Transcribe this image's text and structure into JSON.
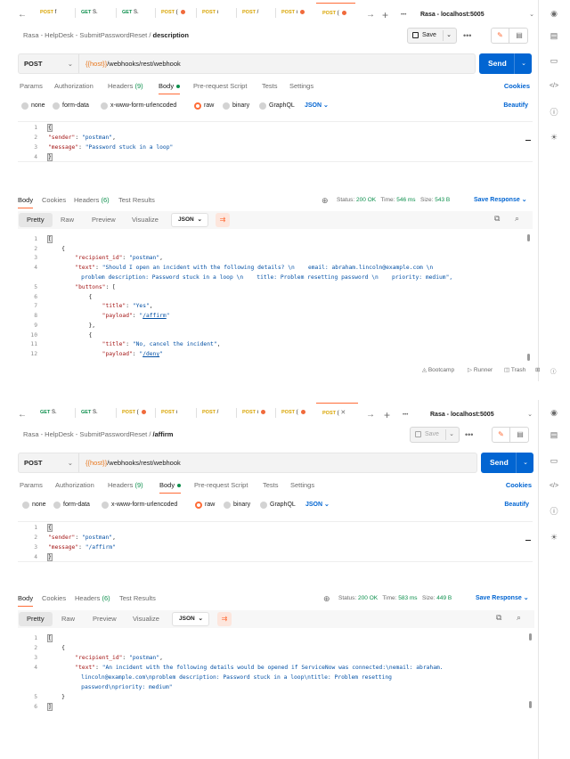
{
  "tabs": [
    {
      "method": "POST",
      "tail": "f",
      "dot": false
    },
    {
      "method": "GET",
      "tail": "S.",
      "dot": false
    },
    {
      "method": "GET",
      "tail": "S.",
      "dot": false
    },
    {
      "method": "POST",
      "tail": "(",
      "dot": true
    },
    {
      "method": "POST",
      "tail": "ı",
      "dot": false
    },
    {
      "method": "POST",
      "tail": "/",
      "dot": false
    },
    {
      "method": "POST",
      "tail": "ı",
      "dot": true
    },
    {
      "method": "POST",
      "tail": "(",
      "dot": true
    }
  ],
  "icons": {
    "back": "←",
    "forward": "→",
    "new_tab": "+",
    "more": "•••",
    "chevron": "⌄",
    "close": "✕",
    "pencil": "✎",
    "doc": "▤",
    "eye": "◉",
    "file": "□",
    "comment": "▭",
    "code": "</>",
    "info": "ⓘ",
    "bulb": "☀",
    "globe": "⊕",
    "copy": "⧉",
    "search": "⌕",
    "wrap": "⇉"
  },
  "environment": "Rasa - localhost:5005",
  "breadcrumb": {
    "collection": "Rasa - HelpDesk - SubmitPasswordReset",
    "separator": "/"
  },
  "save_label": "Save",
  "request": {
    "method": "POST",
    "url_var": "{{host}}",
    "url_path": "/webhooks/rest/webhook"
  },
  "send_label": "Send",
  "req_tabs": {
    "params": "Params",
    "authorization": "Authorization",
    "headers": "Headers",
    "headers_count": "(9)",
    "body": "Body",
    "prerequest": "Pre-request Script",
    "tests": "Tests",
    "settings": "Settings",
    "cookies": "Cookies"
  },
  "body_options": {
    "none": "none",
    "form_data": "form-data",
    "urlencoded": "x-www-form-urlencoded",
    "raw": "raw",
    "binary": "binary",
    "graphql": "GraphQL",
    "json": "JSON",
    "beautify": "Beautify"
  },
  "resp_tabs": {
    "body": "Body",
    "cookies": "Cookies",
    "headers": "Headers",
    "headers_count": "(6)",
    "test_results": "Test Results"
  },
  "status": {
    "status_label": "Status:",
    "status_value": "200 OK",
    "time_label": "Time:",
    "size_label": "Size:",
    "save_response": "Save Response"
  },
  "view_modes": {
    "pretty": "Pretty",
    "raw": "Raw",
    "preview": "Preview",
    "visualize": "Visualize",
    "json": "JSON"
  },
  "footer": {
    "bootcamp": "Bootcamp",
    "runner": "Runner",
    "trash": "Trash"
  },
  "panes": [
    {
      "request_name": "description",
      "time_value": "546 ms",
      "size_value": "543 B",
      "req_body": {
        "sender": "postman",
        "message": "Password stuck in a loop"
      },
      "response": {
        "recipient_id": "postman",
        "text_lines": [
          "Should I open an incident with the following details? \\n    email: abraham.lincoln@example.com \\n",
          "    problem description: Password stuck in a loop \\n    title: Problem resetting password \\n    priority: medium\","
        ],
        "buttons": [
          {
            "title": "Yes",
            "payload": "/affirm"
          },
          {
            "title": "No, cancel the incident",
            "payload": "/deny"
          }
        ]
      }
    },
    {
      "request_name": "/affirm",
      "time_value": "583 ms",
      "size_value": "449 B",
      "req_body": {
        "sender": "postman",
        "message": "/affirm"
      },
      "response": {
        "recipient_id": "postman",
        "text_lines": [
          "An incident with the following details would be opened if ServiceNow was connected:\\nemail: abraham.",
          "    lincoln@example.com\\nproblem description: Password stuck in a loop\\ntitle: Problem resetting",
          "    password\\npriority: medium\""
        ]
      }
    }
  ]
}
